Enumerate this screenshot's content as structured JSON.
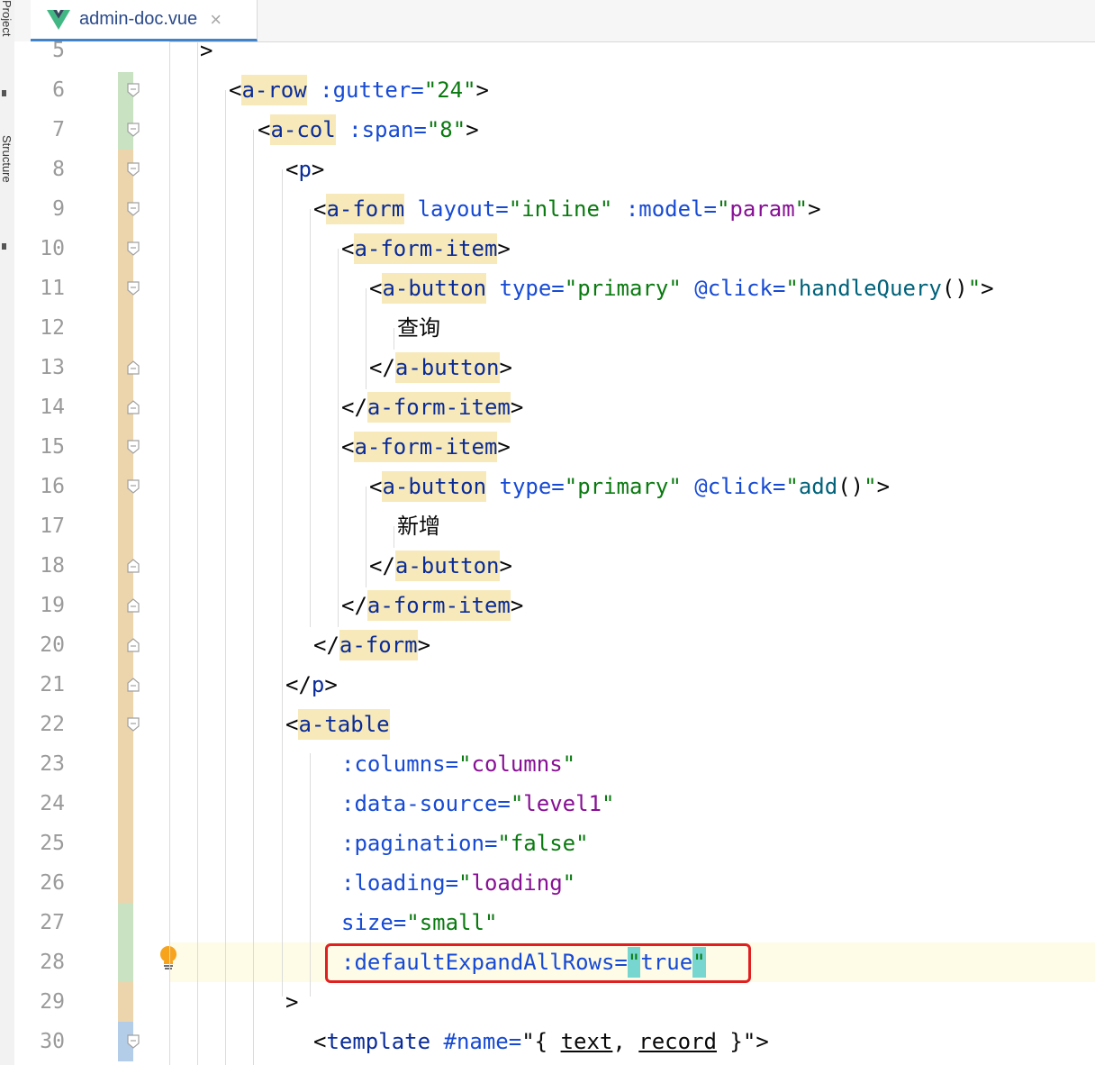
{
  "sidebar": {
    "project_label": "Project",
    "structure_label": "Structure"
  },
  "tab": {
    "title": "admin-doc.vue",
    "close_glyph": "×",
    "icon": "vue-logo-icon"
  },
  "colors": {
    "tag": "#0a2c99",
    "attribute": "#174ad4",
    "string": "#0a7a10",
    "variable": "#871094",
    "tag_highlight": "#f7e9b9",
    "brace_match": "#78d6d0",
    "annotation_box": "#e02020",
    "change_modified": "#ecd5ad",
    "change_added": "#c8e2c2",
    "change_info": "#b3cde8"
  },
  "line_numbers": [
    "5",
    "6",
    "7",
    "8",
    "9",
    "10",
    "11",
    "12",
    "13",
    "14",
    "15",
    "16",
    "17",
    "18",
    "19",
    "20",
    "21",
    "22",
    "23",
    "24",
    "25",
    "26",
    "27",
    "28",
    "29",
    "30"
  ],
  "code_lines": [
    {
      "num": "5",
      "indent": 206,
      "tokens": [
        {
          "t": ">",
          "c": "pun"
        }
      ]
    },
    {
      "num": "6",
      "indent": 238,
      "tokens": [
        {
          "t": "<",
          "c": "pun"
        },
        {
          "t": "a-row",
          "c": "tag",
          "h": 1
        },
        {
          "t": " ",
          "c": "pun"
        },
        {
          "t": ":gutter=",
          "c": "attr"
        },
        {
          "t": "\"24\"",
          "c": "str"
        },
        {
          "t": ">",
          "c": "pun"
        }
      ]
    },
    {
      "num": "7",
      "indent": 270,
      "tokens": [
        {
          "t": "<",
          "c": "pun"
        },
        {
          "t": "a-col",
          "c": "tag",
          "h": 1
        },
        {
          "t": " ",
          "c": "pun"
        },
        {
          "t": ":span=",
          "c": "attr"
        },
        {
          "t": "\"8\"",
          "c": "str"
        },
        {
          "t": ">",
          "c": "pun"
        }
      ]
    },
    {
      "num": "8",
      "indent": 301,
      "tokens": [
        {
          "t": "<",
          "c": "pun"
        },
        {
          "t": "p",
          "c": "tag"
        },
        {
          "t": ">",
          "c": "pun"
        }
      ]
    },
    {
      "num": "9",
      "indent": 332,
      "tokens": [
        {
          "t": "<",
          "c": "pun"
        },
        {
          "t": "a-form",
          "c": "tag",
          "h": 1
        },
        {
          "t": " ",
          "c": "pun"
        },
        {
          "t": "layout=",
          "c": "attr"
        },
        {
          "t": "\"inline\"",
          "c": "str"
        },
        {
          "t": " ",
          "c": "pun"
        },
        {
          "t": ":model=",
          "c": "attr"
        },
        {
          "t": "\"",
          "c": "str"
        },
        {
          "t": "param",
          "c": "var"
        },
        {
          "t": "\"",
          "c": "str"
        },
        {
          "t": ">",
          "c": "pun"
        }
      ]
    },
    {
      "num": "10",
      "indent": 363,
      "tokens": [
        {
          "t": "<",
          "c": "pun"
        },
        {
          "t": "a-form-item",
          "c": "tag",
          "h": 1
        },
        {
          "t": ">",
          "c": "pun"
        }
      ]
    },
    {
      "num": "11",
      "indent": 394,
      "tokens": [
        {
          "t": "<",
          "c": "pun"
        },
        {
          "t": "a-button",
          "c": "tag",
          "h": 1
        },
        {
          "t": " ",
          "c": "pun"
        },
        {
          "t": "type=",
          "c": "attr"
        },
        {
          "t": "\"primary\"",
          "c": "str"
        },
        {
          "t": " ",
          "c": "pun"
        },
        {
          "t": "@click=",
          "c": "attr"
        },
        {
          "t": "\"",
          "c": "str"
        },
        {
          "t": "handleQuery",
          "c": "call"
        },
        {
          "t": "()",
          "c": "pun"
        },
        {
          "t": "\"",
          "c": "str"
        },
        {
          "t": ">",
          "c": "pun"
        }
      ]
    },
    {
      "num": "12",
      "indent": 425,
      "tokens": [
        {
          "t": "查询",
          "c": "plain"
        }
      ]
    },
    {
      "num": "13",
      "indent": 394,
      "tokens": [
        {
          "t": "</",
          "c": "pun"
        },
        {
          "t": "a-button",
          "c": "tag",
          "h": 1
        },
        {
          "t": ">",
          "c": "pun"
        }
      ]
    },
    {
      "num": "14",
      "indent": 363,
      "tokens": [
        {
          "t": "</",
          "c": "pun"
        },
        {
          "t": "a-form-item",
          "c": "tag",
          "h": 1
        },
        {
          "t": ">",
          "c": "pun"
        }
      ]
    },
    {
      "num": "15",
      "indent": 363,
      "tokens": [
        {
          "t": "<",
          "c": "pun"
        },
        {
          "t": "a-form-item",
          "c": "tag",
          "h": 1
        },
        {
          "t": ">",
          "c": "pun"
        }
      ]
    },
    {
      "num": "16",
      "indent": 394,
      "tokens": [
        {
          "t": "<",
          "c": "pun"
        },
        {
          "t": "a-button",
          "c": "tag",
          "h": 1
        },
        {
          "t": " ",
          "c": "pun"
        },
        {
          "t": "type=",
          "c": "attr"
        },
        {
          "t": "\"primary\"",
          "c": "str"
        },
        {
          "t": " ",
          "c": "pun"
        },
        {
          "t": "@click=",
          "c": "attr"
        },
        {
          "t": "\"",
          "c": "str"
        },
        {
          "t": "add",
          "c": "call"
        },
        {
          "t": "()",
          "c": "pun"
        },
        {
          "t": "\"",
          "c": "str"
        },
        {
          "t": ">",
          "c": "pun"
        }
      ]
    },
    {
      "num": "17",
      "indent": 425,
      "tokens": [
        {
          "t": "新增",
          "c": "plain"
        }
      ]
    },
    {
      "num": "18",
      "indent": 394,
      "tokens": [
        {
          "t": "</",
          "c": "pun"
        },
        {
          "t": "a-button",
          "c": "tag",
          "h": 1
        },
        {
          "t": ">",
          "c": "pun"
        }
      ]
    },
    {
      "num": "19",
      "indent": 363,
      "tokens": [
        {
          "t": "</",
          "c": "pun"
        },
        {
          "t": "a-form-item",
          "c": "tag",
          "h": 1
        },
        {
          "t": ">",
          "c": "pun"
        }
      ]
    },
    {
      "num": "20",
      "indent": 332,
      "tokens": [
        {
          "t": "</",
          "c": "pun"
        },
        {
          "t": "a-form",
          "c": "tag",
          "h": 1
        },
        {
          "t": ">",
          "c": "pun"
        }
      ]
    },
    {
      "num": "21",
      "indent": 301,
      "tokens": [
        {
          "t": "</",
          "c": "pun"
        },
        {
          "t": "p",
          "c": "tag"
        },
        {
          "t": ">",
          "c": "pun"
        }
      ]
    },
    {
      "num": "22",
      "indent": 301,
      "tokens": [
        {
          "t": "<",
          "c": "pun"
        },
        {
          "t": "a-table",
          "c": "tag",
          "h": 1
        }
      ]
    },
    {
      "num": "23",
      "indent": 363,
      "tokens": [
        {
          "t": ":columns=",
          "c": "attr"
        },
        {
          "t": "\"",
          "c": "str"
        },
        {
          "t": "columns",
          "c": "var"
        },
        {
          "t": "\"",
          "c": "str"
        }
      ]
    },
    {
      "num": "24",
      "indent": 363,
      "tokens": [
        {
          "t": ":data-source=",
          "c": "attr"
        },
        {
          "t": "\"",
          "c": "str"
        },
        {
          "t": "level1",
          "c": "var"
        },
        {
          "t": "\"",
          "c": "str"
        }
      ]
    },
    {
      "num": "25",
      "indent": 363,
      "tokens": [
        {
          "t": ":pagination=",
          "c": "attr"
        },
        {
          "t": "\"false\"",
          "c": "str"
        }
      ]
    },
    {
      "num": "26",
      "indent": 363,
      "tokens": [
        {
          "t": ":loading=",
          "c": "attr"
        },
        {
          "t": "\"",
          "c": "str"
        },
        {
          "t": "loading",
          "c": "var"
        },
        {
          "t": "\"",
          "c": "str"
        }
      ]
    },
    {
      "num": "27",
      "indent": 363,
      "tokens": [
        {
          "t": "size=",
          "c": "attr"
        },
        {
          "t": "\"small\"",
          "c": "str"
        }
      ]
    },
    {
      "num": "28",
      "indent": 363,
      "tokens": [
        {
          "t": ":defaultExpandAllRows=",
          "c": "attr"
        },
        {
          "t": "\"",
          "c": "str",
          "cy": 1
        },
        {
          "t": "true",
          "c": "attr"
        },
        {
          "t": "\"",
          "c": "str",
          "cy": 1
        }
      ]
    },
    {
      "num": "29",
      "indent": 301,
      "tokens": [
        {
          "t": ">",
          "c": "pun"
        }
      ]
    },
    {
      "num": "30",
      "indent": 332,
      "tokens": [
        {
          "t": "<",
          "c": "pun"
        },
        {
          "t": "template",
          "c": "tag"
        },
        {
          "t": " ",
          "c": "pun"
        },
        {
          "t": "#name=",
          "c": "attr"
        },
        {
          "t": "\"{ ",
          "c": "pun"
        },
        {
          "t": "text",
          "c": "pun",
          "u": 1
        },
        {
          "t": ", ",
          "c": "pun"
        },
        {
          "t": "record",
          "c": "pun",
          "u": 1
        },
        {
          "t": " }",
          "c": "pun"
        },
        {
          "t": "\"",
          "c": "pun"
        },
        {
          "t": ">",
          "c": "pun"
        }
      ]
    }
  ],
  "change_bars": [
    {
      "from": "6",
      "to": "7",
      "kind": "added"
    },
    {
      "from": "8",
      "to": "26",
      "kind": "modified"
    },
    {
      "from": "27",
      "to": "28",
      "kind": "added"
    },
    {
      "from": "29",
      "to": "29",
      "kind": "modified"
    },
    {
      "from": "30",
      "to": "30",
      "kind": "info"
    }
  ],
  "fold_markers": {
    "open": [
      "6",
      "7",
      "8",
      "9",
      "10",
      "11",
      "15",
      "16",
      "22",
      "30"
    ],
    "close": [
      "13",
      "14",
      "18",
      "19",
      "20",
      "21"
    ]
  },
  "intention_bulb_line": "28",
  "annotated_line": "28"
}
